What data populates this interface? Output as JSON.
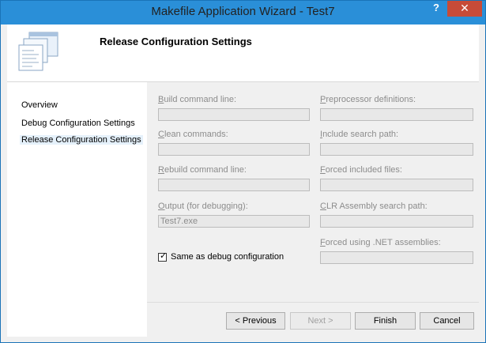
{
  "window": {
    "title": "Makefile Application Wizard - Test7",
    "help_glyph": "?",
    "close_glyph": "✕"
  },
  "header": {
    "title": "Release Configuration Settings",
    "icon": "wizard-pages-icon"
  },
  "nav": {
    "items": [
      {
        "label": "Overview"
      },
      {
        "label": "Debug Configuration Settings"
      },
      {
        "label": "Release Configuration Settings",
        "selected": true
      }
    ]
  },
  "left": {
    "build_label": "Build command line:",
    "build_value": "",
    "clean_label": "Clean commands:",
    "clean_value": "",
    "rebuild_label": "Rebuild command line:",
    "rebuild_value": "",
    "output_label": "Output (for debugging):",
    "output_value": "Test7.exe",
    "same_as_debug_label": "Same as debug configuration",
    "same_as_debug_checked": true
  },
  "right": {
    "preproc_label": "Preprocessor definitions:",
    "preproc_value": "",
    "include_label": "Include search path:",
    "include_value": "",
    "forced_inc_label": "Forced included files:",
    "forced_inc_value": "",
    "clr_label": "CLR Assembly search path:",
    "clr_value": "",
    "forced_net_label": "Forced using .NET assemblies:",
    "forced_net_value": ""
  },
  "buttons": {
    "previous": "< Previous",
    "next": "Next >",
    "finish": "Finish",
    "cancel": "Cancel"
  },
  "colors": {
    "title_bar": "#2a8fd8",
    "close_button": "#c74b38",
    "selected_nav": "#e5f1fb"
  }
}
